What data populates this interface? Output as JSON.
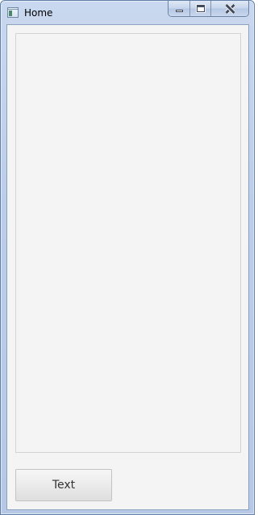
{
  "window": {
    "title": "Home",
    "icon": "app-window-icon",
    "controls": {
      "minimize_icon": "minimize-icon",
      "maximize_icon": "maximize-icon",
      "close_icon": "close-icon"
    }
  },
  "main": {
    "button_label": "Text"
  },
  "colors": {
    "frame": "#b9cbe7",
    "client_background": "#f4f4f4",
    "panel_border": "#d3d3d3",
    "button_text": "#333333"
  }
}
